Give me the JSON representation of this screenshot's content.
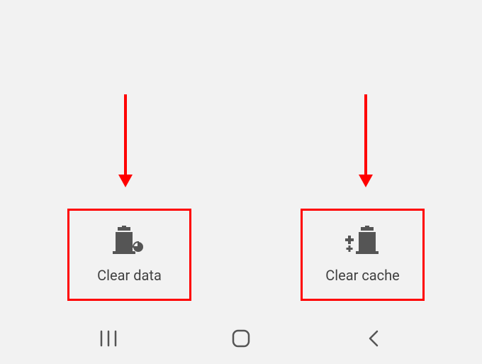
{
  "buttons": {
    "clear_data": {
      "label": "Clear data"
    },
    "clear_cache": {
      "label": "Clear cache"
    }
  },
  "annotations": {
    "arrow_color": "#ff0000",
    "highlight_color": "#ff0000"
  },
  "nav": {
    "recents": "recents",
    "home": "home",
    "back": "back"
  }
}
